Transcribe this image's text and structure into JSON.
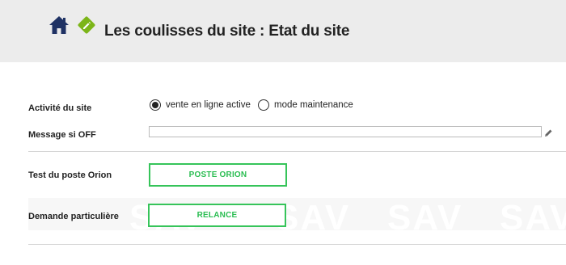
{
  "header": {
    "home_icon": "home-icon",
    "edit_icon": "edit-diamond-icon",
    "title": "Les coulisses du site : Etat du site"
  },
  "form": {
    "activity": {
      "label": "Activité du site",
      "options": [
        {
          "label": "vente en ligne active",
          "checked": true
        },
        {
          "label": "mode maintenance",
          "checked": false
        }
      ]
    },
    "message": {
      "label": "Message si OFF",
      "value": "",
      "edit_icon": "pencil-icon"
    },
    "orion": {
      "label": "Test du poste Orion",
      "button": "POSTE ORION"
    },
    "request": {
      "label": "Demande particulière",
      "button": "RELANCE"
    }
  },
  "watermark": {
    "text": "SAV"
  },
  "colors": {
    "header_bg": "#ececec",
    "icon_navy": "#1f3264",
    "icon_green": "#7cb518",
    "button_green": "#36c45a"
  }
}
